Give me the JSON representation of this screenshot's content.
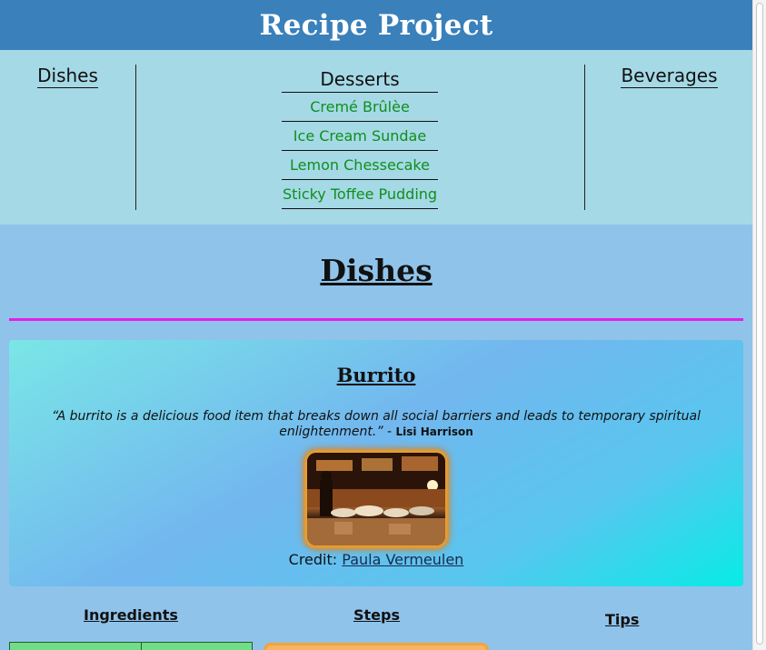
{
  "header": {
    "title": "Recipe Project"
  },
  "nav": {
    "dishes": "Dishes",
    "desserts": {
      "title": "Desserts",
      "items": [
        "Cremé Brûlèe",
        "Ice Cream Sundae",
        "Lemon Chessecake",
        "Sticky Toffee Pudding"
      ]
    },
    "beverages": "Beverages"
  },
  "section": {
    "title": "Dishes"
  },
  "card": {
    "title": "Burrito",
    "quote": "“A burrito is a delicious food item that breaks down all social barriers and leads to temporary spiritual enlightenment.”",
    "quote_separator": " - ",
    "quote_author": "Lisi Harrison",
    "image_alt": "Burrito photo",
    "credit_label": "Credit:",
    "credit_name": "Paula Vermeulen"
  },
  "subsections": {
    "ingredients": "Ingredients",
    "steps": "Steps",
    "tips": "Tips"
  },
  "colors": {
    "header_bg": "#3a80bb",
    "nav_bg": "#a5d9e6",
    "page_bg": "#8fc3ea",
    "link_green": "#0f8f1c",
    "divider": "#e51ee9"
  }
}
